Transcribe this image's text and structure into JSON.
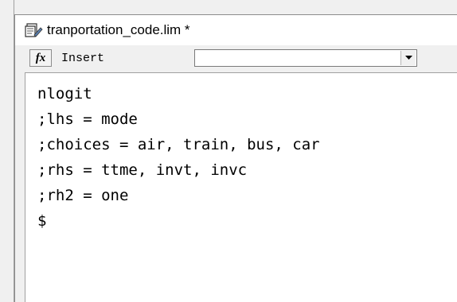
{
  "window": {
    "title": "tranportation_code.lim *",
    "icon": "document-icon"
  },
  "toolbar": {
    "fx_label": "fx",
    "insert_label": "Insert",
    "insert_select_value": ""
  },
  "editor": {
    "lines": [
      "nlogit",
      ";lhs = mode",
      ";choices = air, train, bus, car",
      ";rhs = ttme, invt, invc",
      ";rh2 = one",
      "$"
    ]
  }
}
